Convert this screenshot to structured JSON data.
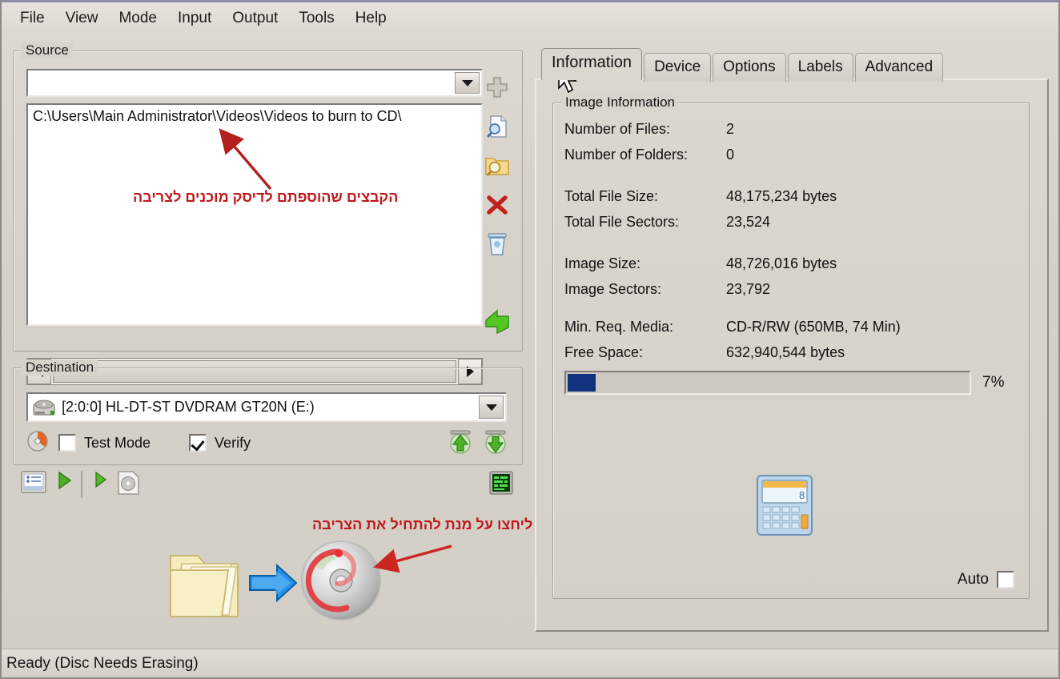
{
  "app": {
    "status_bar": "Ready (Disc Needs Erasing)",
    "accent_progress_color": "#11337e",
    "annotation_color": "#c0181b",
    "window_bg": "#d6d2ca"
  },
  "menubar": {
    "items": [
      {
        "label": "File"
      },
      {
        "label": "View"
      },
      {
        "label": "Mode"
      },
      {
        "label": "Input"
      },
      {
        "label": "Output"
      },
      {
        "label": "Tools"
      },
      {
        "label": "Help"
      }
    ]
  },
  "source": {
    "legend": "Source",
    "combo_value": "",
    "combo_placeholder": "",
    "list_items": [
      "C:\\Users\\Main Administrator\\Videos\\Videos to burn to CD\\"
    ],
    "scroll": {
      "left_arrow": "◀",
      "right_arrow": "▶"
    },
    "tool_icons": [
      {
        "name": "add-files-icon",
        "label": "Add"
      },
      {
        "name": "browse-file-icon",
        "label": "Browse for a file"
      },
      {
        "name": "browse-folder-icon",
        "label": "Browse for a folder"
      },
      {
        "name": "remove-icon",
        "label": "Remove"
      },
      {
        "name": "clear-list-icon",
        "label": "Clear list"
      },
      {
        "name": "green-arrow-icon",
        "label": "Load"
      }
    ]
  },
  "destination": {
    "legend": "Destination",
    "combo_value": "[2:0:0] HL-DT-ST DVDRAM GT20N (E:)",
    "test_mode": {
      "label": "Test Mode",
      "checked": false
    },
    "verify": {
      "label": "Verify",
      "checked": true
    },
    "eject_icons": [
      {
        "name": "eject-up-icon"
      },
      {
        "name": "load-down-icon"
      }
    ]
  },
  "bottom_toolbar": {
    "icons": [
      {
        "name": "device-info-icon"
      },
      {
        "name": "play-green-icon"
      },
      {
        "name": "separator"
      },
      {
        "name": "play-small-icon"
      },
      {
        "name": "disc-tool-icon"
      },
      {
        "name": "log-window-icon"
      }
    ]
  },
  "big_action": {
    "folder_icon": "folder-icon",
    "arrow_icon": "blue-arrow-right-icon",
    "disc_icon": "burn-disc-icon"
  },
  "tabs": {
    "items": [
      {
        "label": "Information",
        "active": true
      },
      {
        "label": "Device",
        "active": false
      },
      {
        "label": "Options",
        "active": false
      },
      {
        "label": "Labels",
        "active": false
      },
      {
        "label": "Advanced",
        "active": false
      }
    ]
  },
  "image_information": {
    "legend": "Image Information",
    "rows": [
      {
        "key": "Number of Files:",
        "value": "2"
      },
      {
        "key": "Number of Folders:",
        "value": "0"
      },
      {
        "key": "Total File Size:",
        "value": "48,175,234 bytes"
      },
      {
        "key": "Total File Sectors:",
        "value": "23,524"
      },
      {
        "key": "Image Size:",
        "value": "48,726,016 bytes"
      },
      {
        "key": "Image Sectors:",
        "value": "23,792"
      },
      {
        "key": "Min. Req. Media:",
        "value": "CD-R/RW (650MB, 74 Min)"
      },
      {
        "key": "Free Space:",
        "value": "632,940,544 bytes"
      }
    ],
    "progress": {
      "percent_label": "7%",
      "percent": 7
    },
    "calculator_icon": "calculator-icon",
    "auto": {
      "label": "Auto",
      "checked": false
    }
  },
  "annotations": {
    "files_ready": "הקבצים שהוספתם לדיסק מוכנים לצריבה",
    "click_to_burn": "ליחצו על מנת להתחיל את הצריבה"
  }
}
